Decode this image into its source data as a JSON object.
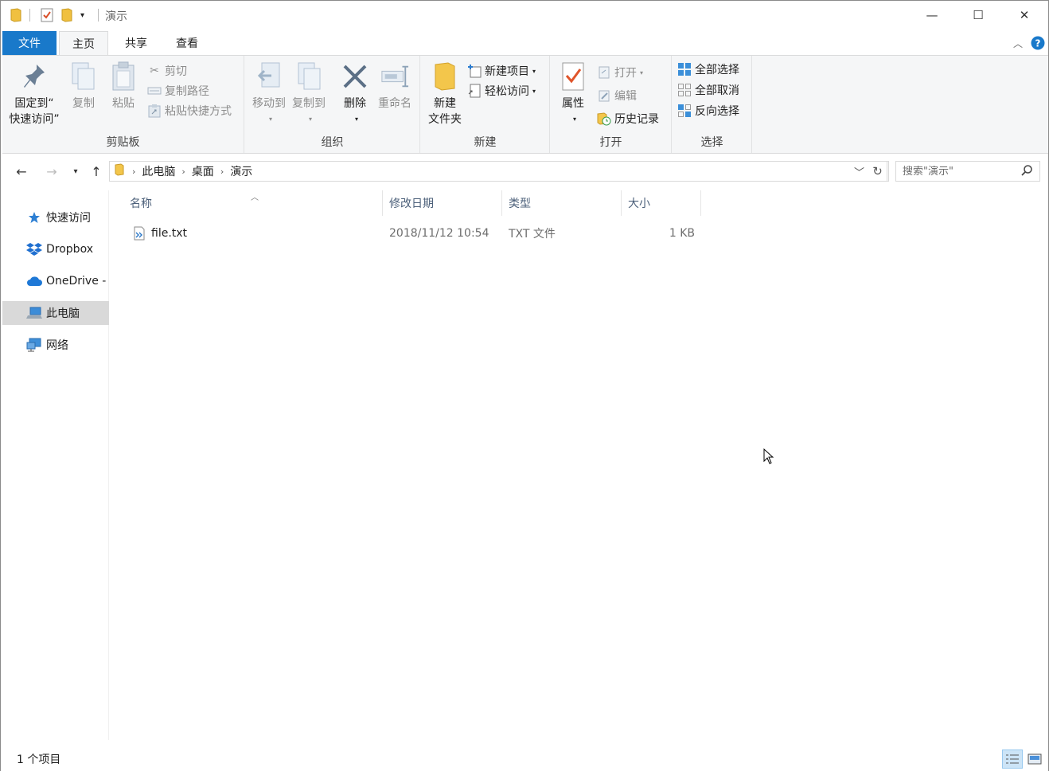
{
  "window": {
    "title": "演示",
    "controls": {
      "minimize": "—",
      "maximize": "☐",
      "close": "✕"
    }
  },
  "tabs": {
    "file": "文件",
    "home": "主页",
    "share": "共享",
    "view": "查看"
  },
  "ribbon": {
    "clipboard": {
      "label": "剪贴板",
      "pin": "固定到“\n快速访问”",
      "copy": "复制",
      "paste": "粘贴",
      "cut": "剪切",
      "copy_path": "复制路径",
      "paste_shortcut": "粘贴快捷方式"
    },
    "organize": {
      "label": "组织",
      "move_to": "移动到",
      "copy_to": "复制到",
      "delete": "删除",
      "rename": "重命名"
    },
    "new": {
      "label": "新建",
      "new_folder": "新建\n文件夹",
      "new_item": "新建项目",
      "easy_access": "轻松访问"
    },
    "open": {
      "label": "打开",
      "properties": "属性",
      "open": "打开",
      "edit": "编辑",
      "history": "历史记录"
    },
    "select": {
      "label": "选择",
      "select_all": "全部选择",
      "select_none": "全部取消",
      "invert": "反向选择"
    }
  },
  "address": {
    "breadcrumbs": [
      "此电脑",
      "桌面",
      "演示"
    ],
    "search_placeholder": "搜索\"演示\""
  },
  "nav": {
    "items": [
      {
        "label": "快速访问",
        "icon": "star-icon"
      },
      {
        "label": "Dropbox",
        "icon": "dropbox-icon"
      },
      {
        "label": "OneDrive -",
        "icon": "cloud-icon"
      },
      {
        "label": "此电脑",
        "icon": "computer-icon",
        "selected": true
      },
      {
        "label": "网络",
        "icon": "network-icon"
      }
    ]
  },
  "columns": {
    "name": "名称",
    "modified": "修改日期",
    "type": "类型",
    "size": "大小"
  },
  "files": [
    {
      "name": "file.txt",
      "modified": "2018/11/12 10:54",
      "type": "TXT 文件",
      "size": "1 KB"
    }
  ],
  "status": {
    "count": "1 个项目"
  },
  "colors": {
    "accent": "#1979ca",
    "ribbon_bg": "#f5f6f7",
    "selected_nav": "#d9d9d9"
  }
}
